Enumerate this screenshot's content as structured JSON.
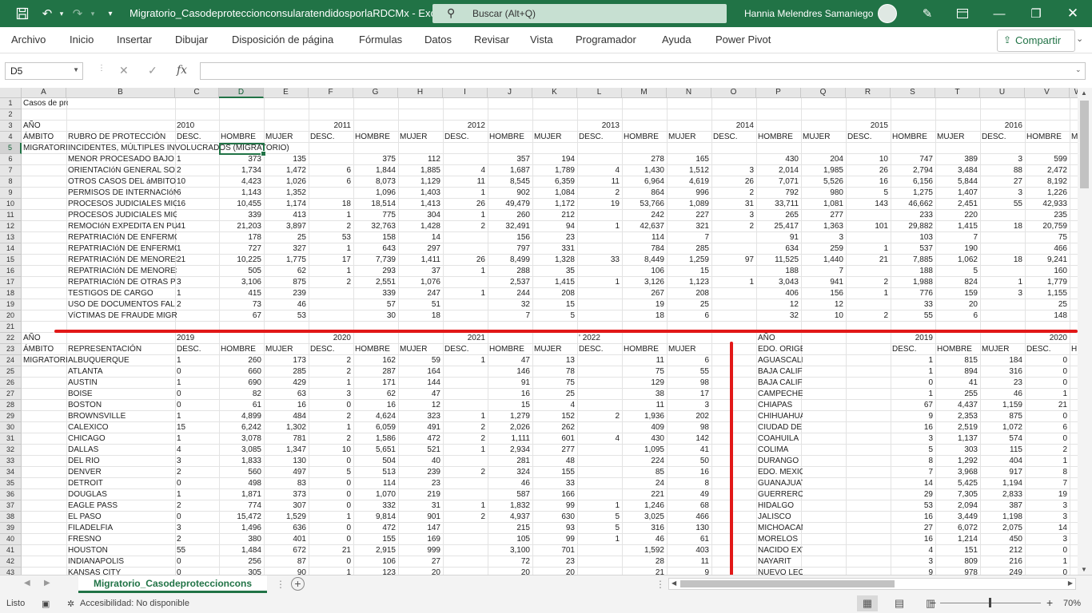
{
  "titlebar": {
    "doc_title": "Migratorio_CasodeproteccionconsularatendidosporlaRDCMx  -  Excel",
    "search_placeholder": "Buscar (Alt+Q)",
    "user_name": "Hannia Melendres Samaniego"
  },
  "ribbon": {
    "tabs": [
      "Archivo",
      "Inicio",
      "Insertar",
      "Dibujar",
      "Disposición de página",
      "Fórmulas",
      "Datos",
      "Revisar",
      "Vista",
      "Programador",
      "Ayuda",
      "Power Pivot"
    ],
    "share_label": "Compartir"
  },
  "formula_bar": {
    "name_box": "D5",
    "fx_label": "fx",
    "value": ""
  },
  "columns": [
    "A",
    "B",
    "C",
    "D",
    "E",
    "F",
    "G",
    "H",
    "I",
    "J",
    "K",
    "L",
    "M",
    "N",
    "O",
    "P",
    "Q",
    "R",
    "S",
    "T",
    "U",
    "V",
    "W"
  ],
  "rows": [
    [
      "1",
      "Casos de proteccion  y/o asistencia consular atendidos en la RDCM en Estados Unidos - ámbito migratorio"
    ],
    [
      "2"
    ],
    [
      "3",
      "AÑO",
      "",
      "2010",
      "",
      "",
      "2011",
      "",
      "",
      "2012",
      "",
      "",
      "2013",
      "",
      "",
      "2014",
      "",
      "",
      "2015",
      "",
      "",
      "2016",
      ""
    ],
    [
      "4",
      "ÁMBITO",
      "RUBRO DE PROTECCIÓN",
      "DESC.",
      "HOMBRE",
      "MUJER",
      "DESC.",
      "HOMBRE",
      "MUJER",
      "DESC.",
      "HOMBRE",
      "MUJER",
      "DESC.",
      "HOMBRE",
      "MUJER",
      "DESC.",
      "HOMBRE",
      "MUJER",
      "DESC.",
      "HOMBRE",
      "MUJER",
      "DESC.",
      "HOMBRE",
      "M"
    ],
    [
      "5",
      "MIGRATORIO",
      "INCIDENTES, MÚLTIPLES INVOLUCRADOS (MIGRATORIO)"
    ],
    [
      "6",
      "",
      "MENOR PROCESADO BAJO",
      "1",
      "373",
      "135",
      "",
      "375",
      "112",
      "",
      "357",
      "194",
      "",
      "278",
      "165",
      "",
      "430",
      "204",
      "10",
      "747",
      "389",
      "3",
      "599"
    ],
    [
      "7",
      "",
      "ORIENTACIóN GENERAL SO",
      "2",
      "1,734",
      "1,472",
      "6",
      "1,844",
      "1,885",
      "4",
      "1,687",
      "1,789",
      "4",
      "1,430",
      "1,512",
      "3",
      "2,014",
      "1,985",
      "26",
      "2,794",
      "3,484",
      "88",
      "2,472"
    ],
    [
      "8",
      "",
      "OTROS CASOS DEL áMBITO",
      "10",
      "4,423",
      "1,026",
      "6",
      "8,073",
      "1,129",
      "11",
      "8,545",
      "6,359",
      "11",
      "6,964",
      "4,619",
      "26",
      "7,071",
      "5,526",
      "16",
      "6,156",
      "5,844",
      "27",
      "8,192"
    ],
    [
      "9",
      "",
      "PERMISOS DE INTERNACIóN",
      "6",
      "1,143",
      "1,352",
      "",
      "1,096",
      "1,403",
      "1",
      "902",
      "1,084",
      "2",
      "864",
      "996",
      "2",
      "792",
      "980",
      "5",
      "1,275",
      "1,407",
      "3",
      "1,226"
    ],
    [
      "10",
      "",
      "PROCESOS JUDICIALES MIG",
      "16",
      "10,455",
      "1,174",
      "18",
      "18,514",
      "1,413",
      "26",
      "49,479",
      "1,172",
      "19",
      "53,766",
      "1,089",
      "31",
      "33,711",
      "1,081",
      "143",
      "46,662",
      "2,451",
      "55",
      "42,933"
    ],
    [
      "11",
      "",
      "PROCESOS JUDICIALES MIGRATORIOS",
      "",
      "339",
      "413",
      "1",
      "775",
      "304",
      "1",
      "260",
      "212",
      "",
      "242",
      "227",
      "3",
      "265",
      "277",
      "",
      "233",
      "220",
      "",
      "235"
    ],
    [
      "12",
      "",
      "REMOCIóN EXPEDITA EN PU",
      "41",
      "21,203",
      "3,897",
      "2",
      "32,763",
      "1,428",
      "2",
      "32,491",
      "94",
      "1",
      "42,637",
      "321",
      "2",
      "25,417",
      "1,363",
      "101",
      "29,882",
      "1,415",
      "18",
      "20,759"
    ],
    [
      "13",
      "",
      "REPATRIACIóN DE ENFERMOS EN PROC",
      "",
      "178",
      "25",
      "53",
      "158",
      "14",
      "",
      "156",
      "23",
      "",
      "114",
      "7",
      "",
      "91",
      "3",
      "",
      "103",
      "7",
      "",
      "75"
    ],
    [
      "14",
      "",
      "REPATRIACIóN DE ENFERMO",
      "1",
      "727",
      "327",
      "1",
      "643",
      "297",
      "",
      "797",
      "331",
      "",
      "784",
      "285",
      "",
      "634",
      "259",
      "1",
      "537",
      "190",
      "",
      "466"
    ],
    [
      "15",
      "",
      "REPATRIACIóN DE MENORES",
      "21",
      "10,225",
      "1,775",
      "17",
      "7,739",
      "1,411",
      "26",
      "8,499",
      "1,328",
      "33",
      "8,449",
      "1,259",
      "97",
      "11,525",
      "1,440",
      "21",
      "7,885",
      "1,062",
      "18",
      "9,241"
    ],
    [
      "16",
      "",
      "REPATRIACIóN DE MENORES INFRACTO",
      "",
      "505",
      "62",
      "1",
      "293",
      "37",
      "1",
      "288",
      "35",
      "",
      "106",
      "15",
      "",
      "188",
      "7",
      "",
      "188",
      "5",
      "",
      "160"
    ],
    [
      "17",
      "",
      "REPATRIACIóN DE OTRAS P",
      "3",
      "3,106",
      "875",
      "2",
      "2,551",
      "1,076",
      "",
      "2,537",
      "1,415",
      "1",
      "3,126",
      "1,123",
      "1",
      "3,043",
      "941",
      "2",
      "1,988",
      "824",
      "1",
      "1,779"
    ],
    [
      "18",
      "",
      "TESTIGOS DE CARGO",
      "1",
      "415",
      "239",
      "",
      "339",
      "247",
      "1",
      "244",
      "208",
      "",
      "267",
      "208",
      "",
      "406",
      "156",
      "1",
      "776",
      "159",
      "3",
      "1,155"
    ],
    [
      "19",
      "",
      "USO DE DOCUMENTOS FAL",
      "2",
      "73",
      "46",
      "",
      "57",
      "51",
      "",
      "32",
      "15",
      "",
      "19",
      "25",
      "",
      "12",
      "12",
      "",
      "33",
      "20",
      "",
      "25"
    ],
    [
      "20",
      "",
      "VíCTIMAS DE FRAUDE MIGRATORIO",
      "",
      "67",
      "53",
      "",
      "30",
      "18",
      "",
      "7",
      "5",
      "",
      "18",
      "6",
      "",
      "32",
      "10",
      "2",
      "55",
      "6",
      "",
      "148"
    ],
    [
      "21"
    ],
    [
      "22",
      "AÑO",
      "",
      "2019",
      "",
      "",
      "2020",
      "",
      "",
      "2021",
      "",
      "",
      "' 2022",
      "",
      "",
      "",
      "AÑO",
      "",
      "",
      "2019",
      "",
      "",
      "2020",
      ""
    ],
    [
      "23",
      "ÁMBITO",
      "REPRESENTACIÓN",
      "DESC.",
      "HOMBRE",
      "MUJER",
      "DESC.",
      "HOMBRE",
      "MUJER",
      "DESC.",
      "HOMBRE",
      "MUJER",
      "DESC.",
      "HOMBRE",
      "MUJER",
      "",
      "EDO. ORIGEN",
      "",
      "",
      "DESC.",
      "HOMBRE",
      "MUJER",
      "DESC.",
      "H"
    ],
    [
      "24",
      "MIGRATORIO",
      "ALBUQUERQUE",
      "1",
      "260",
      "173",
      "2",
      "162",
      "59",
      "1",
      "47",
      "13",
      "",
      "11",
      "6",
      "",
      "AGUASCALIENTES",
      "",
      "",
      "1",
      "815",
      "184",
      "0",
      ""
    ],
    [
      "25",
      "",
      "ATLANTA",
      "0",
      "660",
      "285",
      "2",
      "287",
      "164",
      "",
      "146",
      "78",
      "",
      "75",
      "55",
      "",
      "BAJA CALIFORNIA",
      "",
      "",
      "1",
      "894",
      "316",
      "0",
      ""
    ],
    [
      "26",
      "",
      "AUSTIN",
      "1",
      "690",
      "429",
      "1",
      "171",
      "144",
      "",
      "91",
      "75",
      "",
      "129",
      "98",
      "",
      "BAJA CALIFORNIA SUR",
      "",
      "",
      "0",
      "41",
      "23",
      "0",
      ""
    ],
    [
      "27",
      "",
      "BOISE",
      "0",
      "82",
      "63",
      "3",
      "62",
      "47",
      "",
      "16",
      "25",
      "",
      "38",
      "17",
      "",
      "CAMPECHE",
      "",
      "",
      "1",
      "255",
      "46",
      "1",
      ""
    ],
    [
      "28",
      "",
      "BOSTON",
      "0",
      "61",
      "16",
      "0",
      "16",
      "12",
      "",
      "15",
      "4",
      "",
      "11",
      "3",
      "",
      "CHIAPAS",
      "",
      "",
      "67",
      "4,437",
      "1,159",
      "21",
      ""
    ],
    [
      "29",
      "",
      "BROWNSVILLE",
      "1",
      "4,899",
      "484",
      "2",
      "4,624",
      "323",
      "1",
      "1,279",
      "152",
      "2",
      "1,936",
      "202",
      "",
      "CHIHUAHUA",
      "",
      "",
      "9",
      "2,353",
      "875",
      "0",
      ""
    ],
    [
      "30",
      "",
      "CALEXICO",
      "15",
      "6,242",
      "1,302",
      "1",
      "6,059",
      "491",
      "2",
      "2,026",
      "262",
      "",
      "409",
      "98",
      "",
      "CIUDAD DE MÉXICO",
      "",
      "",
      "16",
      "2,519",
      "1,072",
      "6",
      ""
    ],
    [
      "31",
      "",
      "CHICAGO",
      "1",
      "3,078",
      "781",
      "2",
      "1,586",
      "472",
      "2",
      "1,111",
      "601",
      "4",
      "430",
      "142",
      "",
      "COAHUILA",
      "",
      "",
      "3",
      "1,137",
      "574",
      "0",
      ""
    ],
    [
      "32",
      "",
      "DALLAS",
      "4",
      "3,085",
      "1,347",
      "10",
      "5,651",
      "521",
      "1",
      "2,934",
      "277",
      "",
      "1,095",
      "41",
      "",
      "COLIMA",
      "",
      "",
      "5",
      "303",
      "115",
      "2",
      ""
    ],
    [
      "33",
      "",
      "DEL RIO",
      "3",
      "1,833",
      "130",
      "0",
      "504",
      "40",
      "",
      "281",
      "48",
      "",
      "224",
      "50",
      "",
      "DURANGO",
      "",
      "",
      "8",
      "1,292",
      "404",
      "1",
      ""
    ],
    [
      "34",
      "",
      "DENVER",
      "2",
      "560",
      "497",
      "5",
      "513",
      "239",
      "2",
      "324",
      "155",
      "",
      "85",
      "16",
      "",
      "EDO. MEXICO",
      "",
      "",
      "7",
      "3,968",
      "917",
      "8",
      ""
    ],
    [
      "35",
      "",
      "DETROIT",
      "0",
      "498",
      "83",
      "0",
      "114",
      "23",
      "",
      "46",
      "33",
      "",
      "24",
      "8",
      "",
      "GUANAJUATO",
      "",
      "",
      "14",
      "5,425",
      "1,194",
      "7",
      ""
    ],
    [
      "36",
      "",
      "DOUGLAS",
      "1",
      "1,871",
      "373",
      "0",
      "1,070",
      "219",
      "",
      "587",
      "166",
      "",
      "221",
      "49",
      "",
      "GUERRERO",
      "",
      "",
      "29",
      "7,305",
      "2,833",
      "19",
      ""
    ],
    [
      "37",
      "",
      "EAGLE PASS",
      "2",
      "774",
      "307",
      "0",
      "332",
      "31",
      "1",
      "1,832",
      "99",
      "1",
      "1,246",
      "68",
      "",
      "HIDALGO",
      "",
      "",
      "53",
      "2,094",
      "387",
      "3",
      ""
    ],
    [
      "38",
      "",
      "EL PASO",
      "0",
      "15,472",
      "1,529",
      "1",
      "9,814",
      "901",
      "2",
      "4,937",
      "630",
      "5",
      "3,025",
      "466",
      "",
      "JALISCO",
      "",
      "",
      "16",
      "3,449",
      "1,198",
      "3",
      ""
    ],
    [
      "39",
      "",
      "FILADELFIA",
      "3",
      "1,496",
      "636",
      "0",
      "472",
      "147",
      "",
      "215",
      "93",
      "5",
      "316",
      "130",
      "",
      "MICHOACAN",
      "",
      "",
      "27",
      "6,072",
      "2,075",
      "14",
      ""
    ],
    [
      "40",
      "",
      "FRESNO",
      "2",
      "380",
      "401",
      "0",
      "155",
      "169",
      "",
      "105",
      "99",
      "1",
      "46",
      "61",
      "",
      "MORELOS",
      "",
      "",
      "16",
      "1,214",
      "450",
      "3",
      ""
    ],
    [
      "41",
      "",
      "HOUSTON",
      "55",
      "1,484",
      "672",
      "21",
      "2,915",
      "999",
      "",
      "3,100",
      "701",
      "",
      "1,592",
      "403",
      "",
      "NACIDO EXTRANJERO",
      "",
      "",
      "4",
      "151",
      "212",
      "0",
      ""
    ],
    [
      "42",
      "",
      "INDIANAPOLIS",
      "0",
      "256",
      "87",
      "0",
      "106",
      "27",
      "",
      "72",
      "23",
      "",
      "28",
      "11",
      "",
      "NAYARIT",
      "",
      "",
      "3",
      "809",
      "216",
      "1",
      ""
    ],
    [
      "43",
      "",
      "KANSAS CITY",
      "0",
      "305",
      "90",
      "1",
      "123",
      "20",
      "",
      "20",
      "20",
      "",
      "21",
      "9",
      "",
      "NUEVO LEON",
      "",
      "",
      "9",
      "978",
      "249",
      "0",
      ""
    ]
  ],
  "sheet_tab": "Migratorio_Casodeproteccioncons",
  "status": {
    "ready": "Listo",
    "accessibility": "Accesibilidad: No disponible",
    "zoom": "70%"
  }
}
